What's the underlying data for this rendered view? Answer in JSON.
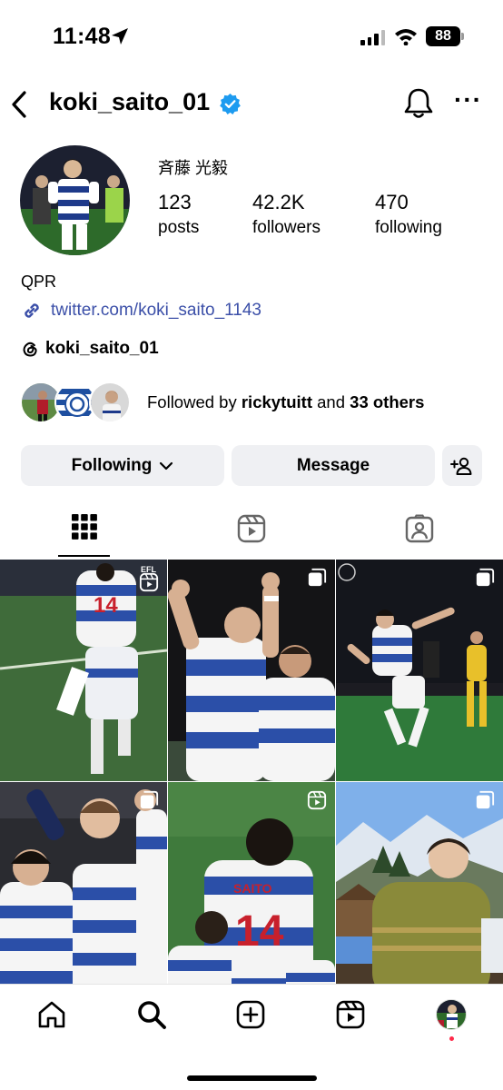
{
  "status_bar": {
    "time": "11:48",
    "battery": "88",
    "icons": [
      "location-arrow-icon",
      "cellular-signal-icon",
      "wifi-icon",
      "battery-icon"
    ]
  },
  "header": {
    "username": "koki_saito_01",
    "icons": [
      "back-chevron-icon",
      "verified-badge-icon",
      "bell-icon",
      "more-icon"
    ],
    "more_label": "···"
  },
  "profile": {
    "full_name": "斉藤 光毅",
    "stats": [
      {
        "value": "123",
        "label": "posts"
      },
      {
        "value": "42.2K",
        "label": "followers"
      },
      {
        "value": "470",
        "label": "following"
      }
    ],
    "bio": "QPR",
    "link": "twitter.com/koki_saito_1143",
    "threads_handle": "koki_saito_01",
    "followed_by": {
      "prefix": "Followed by ",
      "user": "rickytuitt",
      "middle": " and ",
      "others": "33 others"
    }
  },
  "buttons": {
    "following": "Following",
    "message": "Message"
  },
  "tabs": [
    "grid-tab",
    "reels-tab",
    "tagged-tab"
  ],
  "grid": {
    "tiles": [
      {
        "type": "reel",
        "overlay": "EFL"
      },
      {
        "type": "carousel"
      },
      {
        "type": "carousel"
      },
      {
        "type": "carousel"
      },
      {
        "type": "reel"
      },
      {
        "type": "carousel"
      }
    ]
  },
  "bottom_nav": [
    "home-icon",
    "search-icon",
    "create-icon",
    "reels-icon",
    "profile-avatar"
  ],
  "colors": {
    "link": "#3b4fa8",
    "verified": "#1d9bf0",
    "button_bg": "#eff0f3",
    "notification_dot": "#ff2a4a"
  }
}
